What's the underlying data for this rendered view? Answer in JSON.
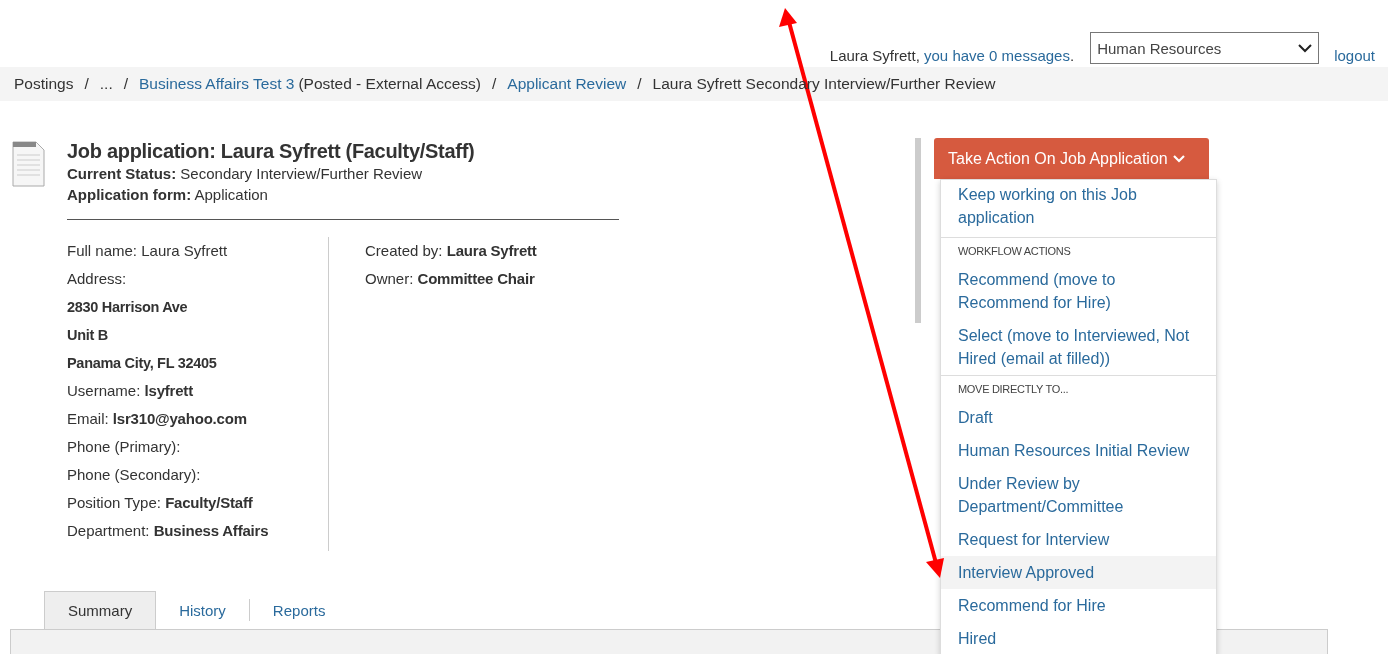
{
  "header": {
    "greeting": {
      "before": "Laura Syfrett, ",
      "link": "you have 0 messages",
      "after": "."
    },
    "department_select": {
      "value": "Human Resources"
    },
    "logout": "logout"
  },
  "breadcrumbs": {
    "separator": "/",
    "items": [
      {
        "kind": "text",
        "text": "Postings"
      },
      {
        "kind": "text",
        "text": "..."
      },
      {
        "kind": "link",
        "text": "Business Affairs Test 3",
        "suffix": "(Posted - External Access)"
      },
      {
        "kind": "link",
        "text": "Applicant Review"
      },
      {
        "kind": "text",
        "text": "Laura Syfrett Secondary Interview/Further Review"
      }
    ]
  },
  "application": {
    "title": "Job application: Laura Syfrett (Faculty/Staff)",
    "status": "**Current Status:** Secondary Interview/Further Review",
    "form": "**Application form:** Application"
  },
  "details": {
    "left": [
      {
        "kind": "field",
        "text": "Full name: Laura Syfrett"
      },
      {
        "kind": "field",
        "text": "Address:"
      },
      {
        "kind": "address-line",
        "text": "2830 Harrison Ave"
      },
      {
        "kind": "address-line",
        "text": "Unit B"
      },
      {
        "kind": "address-line",
        "text": "Panama City, FL 32405"
      },
      {
        "kind": "field",
        "text": "Username: **lsyfrett**"
      },
      {
        "kind": "field",
        "text": "Email: **lsr310@yahoo.com**"
      },
      {
        "kind": "field",
        "text": "Phone (Primary):"
      },
      {
        "kind": "field",
        "text": "Phone (Secondary):"
      },
      {
        "kind": "field",
        "text": "Position Type: **Faculty/Staff**"
      },
      {
        "kind": "field",
        "text": "Department: **Business Affairs**"
      }
    ],
    "right": [
      {
        "kind": "field",
        "text": "Created by: **Laura Syfrett**"
      },
      {
        "kind": "field",
        "text": "Owner: **Committee Chair**"
      }
    ]
  },
  "action_menu": {
    "button": "Take Action On Job Application",
    "expanded": true,
    "sections": [
      {
        "items": [
          {
            "label": "Keep working on this Job application",
            "highlighted": false
          }
        ]
      },
      {
        "heading": "WORKFLOW ACTIONS",
        "items": [
          {
            "label": "Recommend (move to Recommend for Hire)",
            "highlighted": false
          },
          {
            "label": "Select (move to Interviewed, Not Hired (email at filled))",
            "highlighted": false
          }
        ]
      },
      {
        "heading": "MOVE DIRECTLY TO...",
        "items": [
          {
            "label": "Draft",
            "highlighted": false
          },
          {
            "label": "Human Resources Initial Review",
            "highlighted": false
          },
          {
            "label": "Under Review by Department/Committee",
            "highlighted": false
          },
          {
            "label": "Request for Interview",
            "highlighted": false
          },
          {
            "label": "Interview Approved",
            "highlighted": true
          },
          {
            "label": "Recommend for Hire",
            "highlighted": false
          },
          {
            "label": "Hired",
            "highlighted": false
          }
        ]
      }
    ]
  },
  "tabs": [
    {
      "label": "Summary",
      "selected": true
    },
    {
      "label": "History",
      "selected": false
    },
    {
      "label": "Reports",
      "selected": false
    }
  ]
}
